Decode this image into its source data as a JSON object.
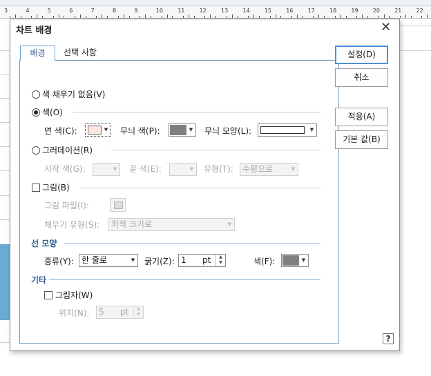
{
  "dialog": {
    "title": "차트 배경",
    "close_glyph": "✕",
    "tabs": [
      "배경",
      "선택 사항"
    ]
  },
  "buttons": {
    "ok": "설정(D)",
    "cancel": "취소",
    "apply": "적용(A)",
    "defaults": "기본 값(B)",
    "help": "?"
  },
  "fill": {
    "no_fill": "색 채우기 없음(V)",
    "color": "색(O)",
    "face_color_label": "면 색(C):",
    "face_color": "#fde6dc",
    "pattern_color_label": "무늬 색(P):",
    "pattern_color": "#808080",
    "pattern_shape_label": "무늬 모양(L):",
    "gradient": "그러데이션(R)",
    "start_color_label": "시작 색(G):",
    "end_color_label": "끝 색(E):",
    "type_label": "유형(T):",
    "type_value": "수평으로",
    "picture": "그림(B)",
    "picture_file_label": "그림 파일(I):",
    "fill_type_label": "채우기 유형(S):",
    "fill_type_value": "최적 크기로"
  },
  "line": {
    "section": "선 모양",
    "kind_label": "종류(Y):",
    "kind_value": "한 줄로",
    "thickness_label": "굵기(Z):",
    "thickness_value": "1",
    "thickness_unit": "pt",
    "color_label": "색(F):",
    "color": "#808080"
  },
  "other": {
    "section": "기타",
    "shadow": "그림자(W)",
    "position_label": "위치(N):",
    "position_value": "5",
    "position_unit": "pt"
  },
  "ruler": {
    "numbers": [
      "3",
      "4",
      "5",
      "6",
      "7",
      "8",
      "9",
      "10",
      "11",
      "12",
      "13",
      "14",
      "15",
      "16",
      "17",
      "18",
      "19",
      "20",
      "21",
      "22"
    ]
  }
}
